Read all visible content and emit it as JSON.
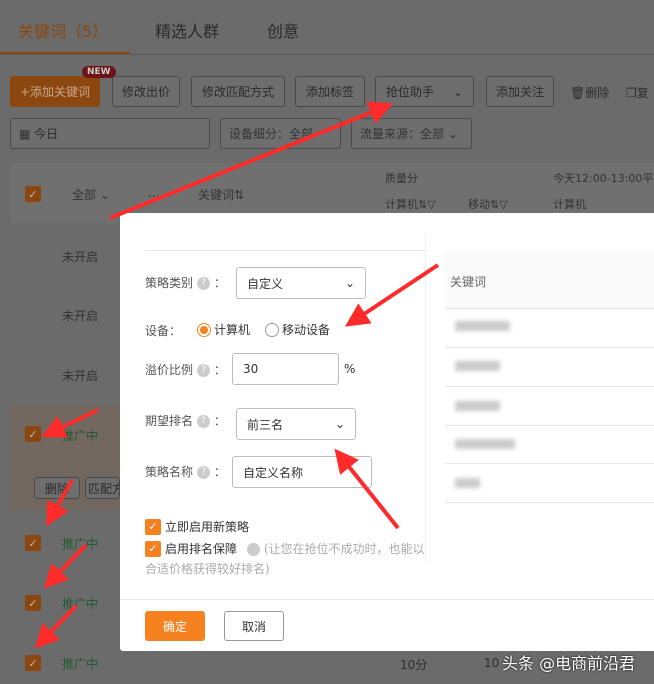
{
  "tabs": [
    "关键词（5）",
    "精选人群",
    "创意"
  ],
  "toolbar": {
    "add_keyword": "+添加关键词",
    "new_badge": "NEW",
    "modify_bid": "修改出价",
    "modify_match": "修改匹配方式",
    "add_tag": "添加标签",
    "rank_helper": "抢位助手",
    "add_follow": "添加关注",
    "delete": "删除",
    "copy": "复"
  },
  "filters": {
    "date": "今日",
    "device": "设备细分：全部",
    "traffic": "流量来源：全部"
  },
  "table": {
    "all": "全部",
    "more": "...",
    "keyword_col": "关键词⇅",
    "quality": "质量分",
    "time_col": "今天12:00-13:00平",
    "pc": "计算机⇅▽",
    "mobile": "移动⇅▽",
    "pc2": "计算机",
    "row_delete": "删除",
    "row_match": "匹配方",
    "statuses": [
      "未开启",
      "未开启",
      "未开启",
      "推广中",
      "推广中",
      "推广中",
      "推广中"
    ],
    "bottom_score": "10分",
    "bottom_score2": "10"
  },
  "modal": {
    "strategy_type_label": "策略类别",
    "strategy_type_value": "自定义",
    "device_label": "设备：",
    "device_options": [
      "计算机",
      "移动设备"
    ],
    "device_selected": "计算机",
    "premium_label": "溢价比例",
    "premium_value": "30",
    "premium_unit": "%",
    "rank_label": "期望排名",
    "rank_value": "前三名",
    "name_label": "策略名称",
    "name_value": "自定义名称",
    "enable_now": "立即启用新策略",
    "enable_guarantee": "启用排名保障",
    "guarantee_hint": "(让您在抢位不成功时，也能以合适价格获得较好排名)",
    "confirm": "确定",
    "cancel": "取消",
    "right_col": "关键词"
  },
  "watermark": "头条 @电商前沿君",
  "colors": {
    "accent": "#f5821f",
    "arrow": "#ff2a2a"
  }
}
